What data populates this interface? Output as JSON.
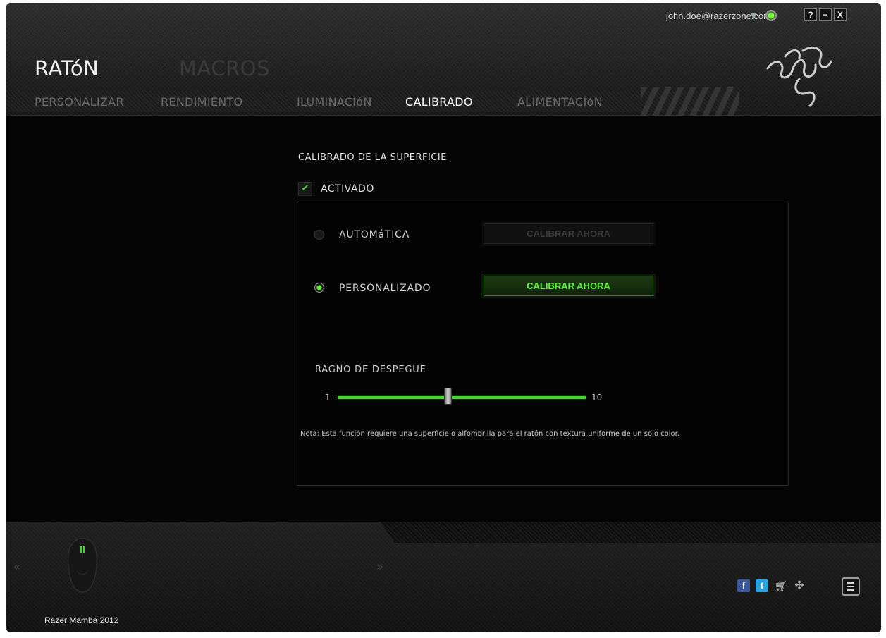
{
  "account": {
    "email": "john.doe@razerzone.com"
  },
  "window_controls": {
    "help": "?",
    "minimize": "−",
    "close": "X"
  },
  "main_tabs": [
    {
      "label": "RATóN",
      "active": true
    },
    {
      "label": "MACROS",
      "active": false
    }
  ],
  "sub_tabs": [
    {
      "label": "PERSONALIZAR",
      "active": false
    },
    {
      "label": "RENDIMIENTO",
      "active": false
    },
    {
      "label": "ILUMINACIóN",
      "active": false
    },
    {
      "label": "CALIBRADO",
      "active": true
    },
    {
      "label": "ALIMENTACIóN",
      "active": false
    }
  ],
  "calibration": {
    "title": "CALIBRADO DE LA SUPERFICIE",
    "enabled_label": "ACTIVADO",
    "enabled": true,
    "options": [
      {
        "label": "AUTOMáTICA",
        "selected": false,
        "button": "CALIBRAR AHORA",
        "button_enabled": false
      },
      {
        "label": "PERSONALIZADO",
        "selected": true,
        "button": "CALIBRAR AHORA",
        "button_enabled": true
      }
    ],
    "lift_off": {
      "title": "RAGNO DE DESPEGUE",
      "min": "1",
      "max": "10",
      "value": 5
    },
    "note": "Nota: Esta función requiere una superficie o alfombrilla para el ratón con textura uniforme de un solo color."
  },
  "footer": {
    "device_name": "Razer Mamba 2012",
    "prev": "«",
    "next": "»",
    "social": [
      "facebook-icon",
      "twitter-icon",
      "cart-icon",
      "razer-icon"
    ]
  },
  "colors": {
    "accent": "#44d62c",
    "background": "#050505"
  }
}
